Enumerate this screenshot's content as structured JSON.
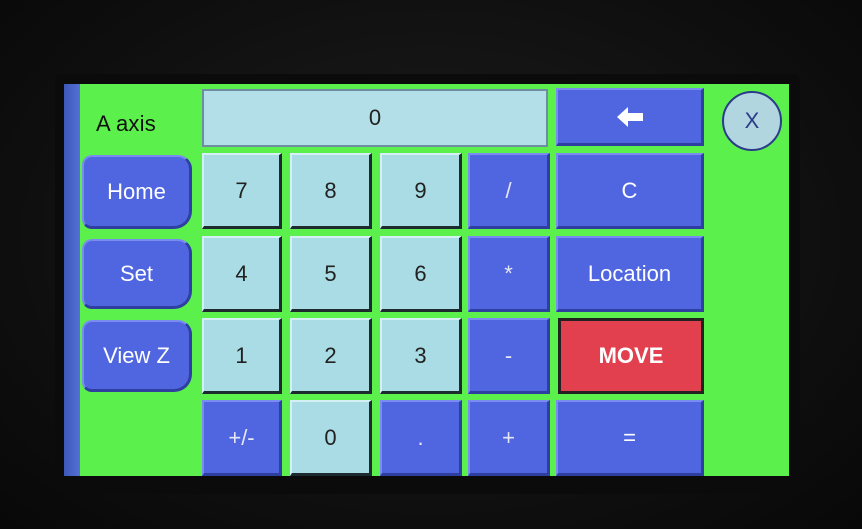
{
  "axis_label": "A axis",
  "display_value": "0",
  "backspace_icon": "left-arrow-icon",
  "close_label": "X",
  "side_buttons": [
    "Home",
    "Set",
    "View Z"
  ],
  "keypad": {
    "row1": [
      "7",
      "8",
      "9",
      "/",
      "C"
    ],
    "row2": [
      "4",
      "5",
      "6",
      "*",
      "Location"
    ],
    "row3": [
      "1",
      "2",
      "3",
      "-",
      "MOVE"
    ],
    "row4": [
      "+/-",
      "0",
      ".",
      "+",
      "="
    ]
  },
  "colors": {
    "screen_bg": "#5cf04c",
    "button_blue": "#4f66e0",
    "key_light": "#a9dce4",
    "move_red": "#e2404f"
  }
}
